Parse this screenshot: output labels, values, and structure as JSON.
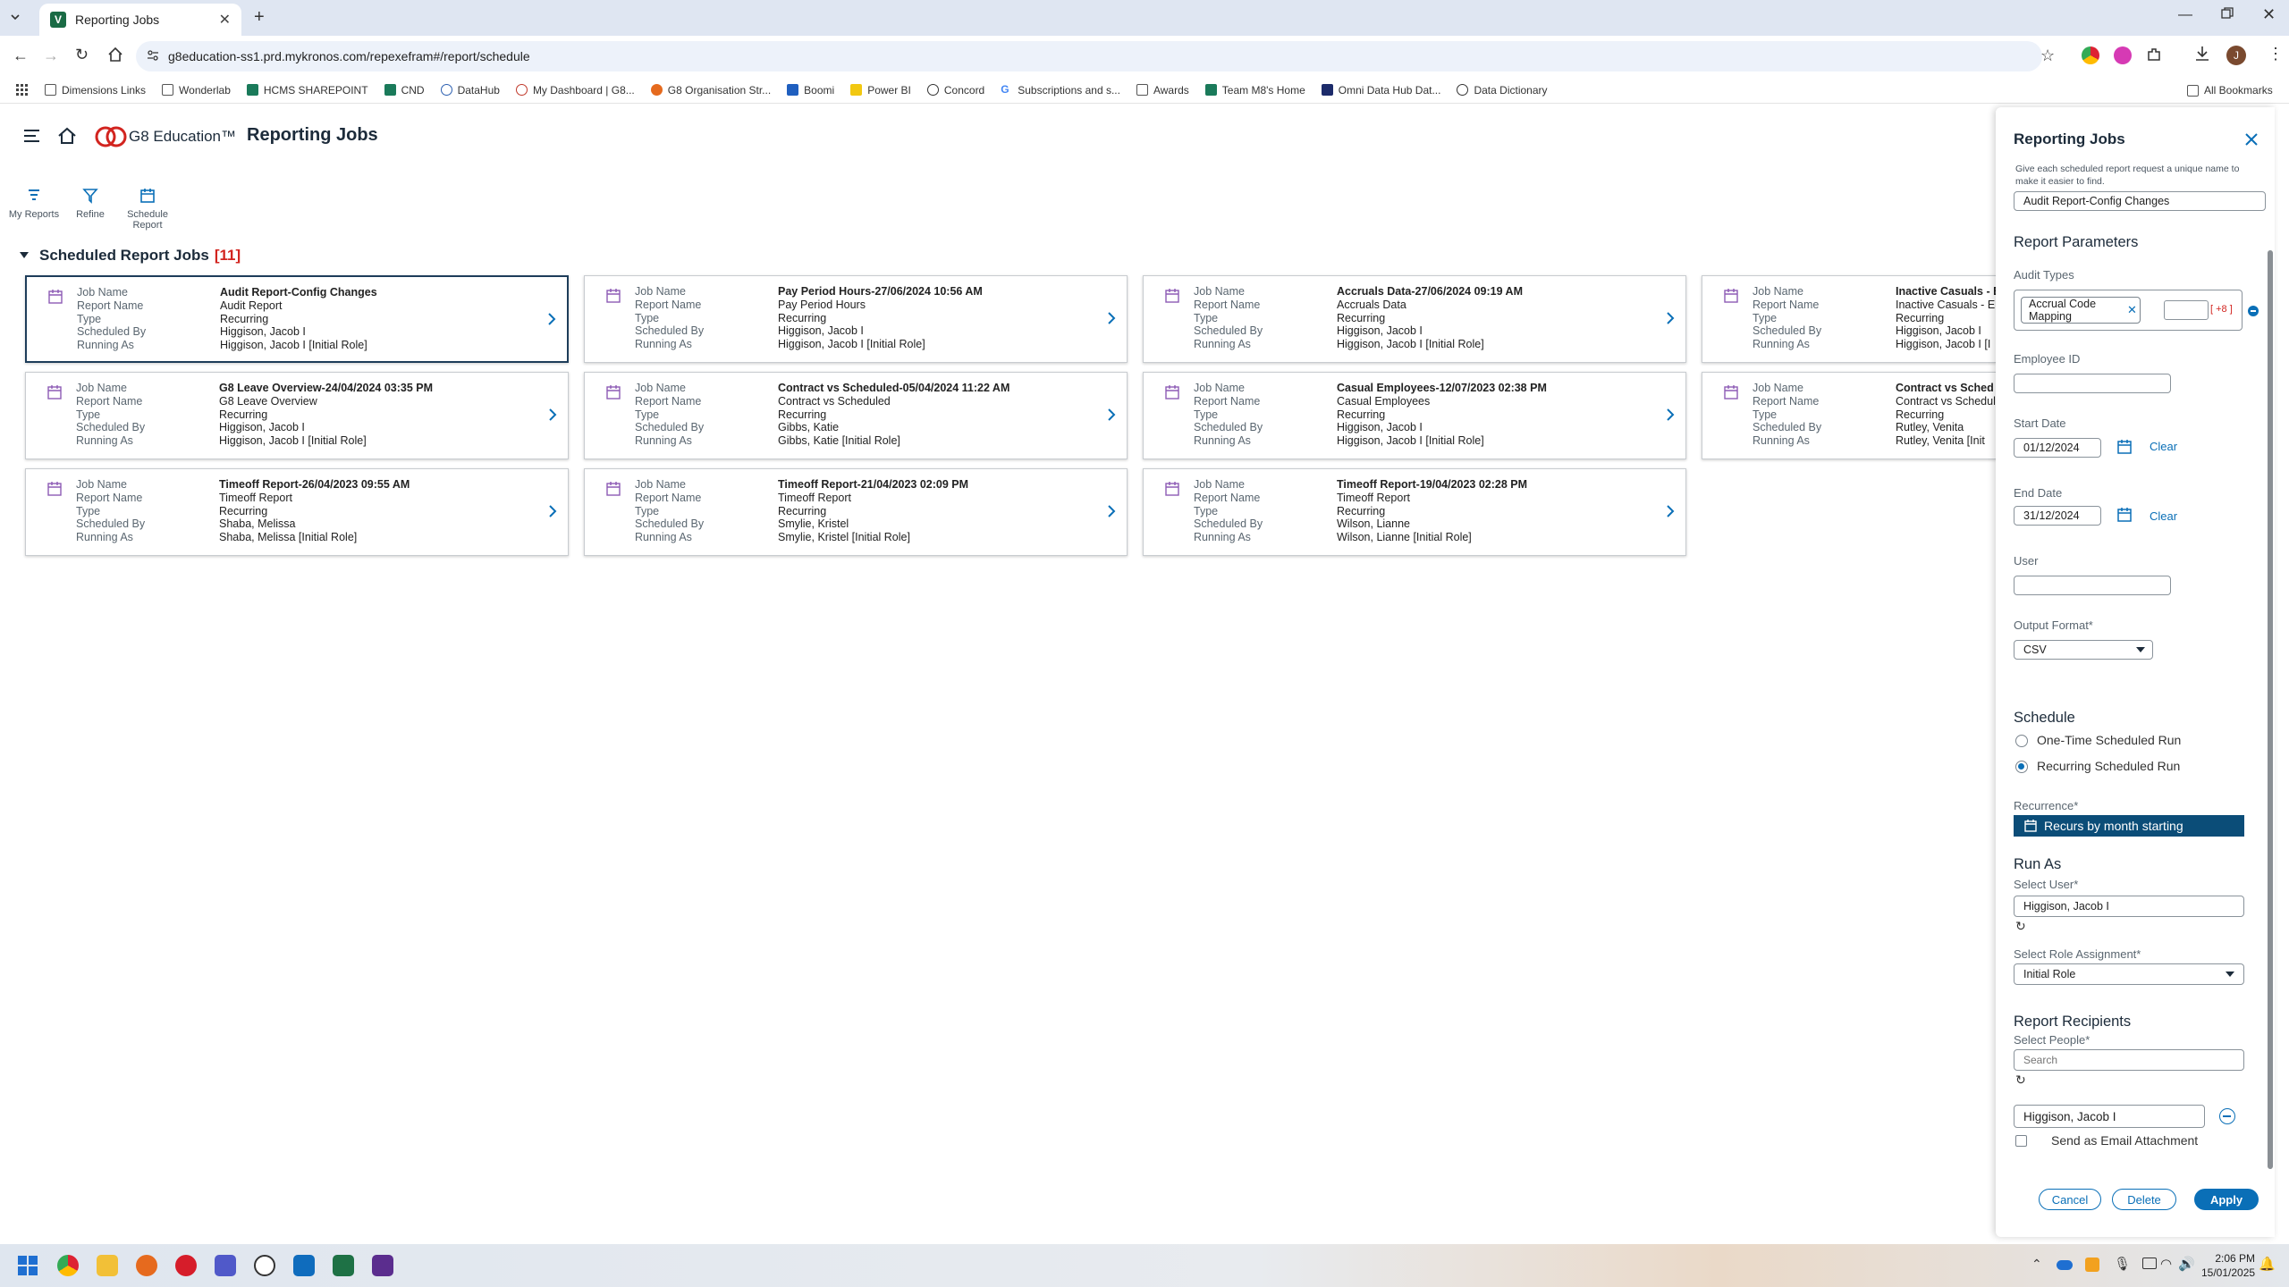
{
  "browser": {
    "tab_title": "Reporting Jobs",
    "url": "g8education-ss1.prd.mykronos.com/repexefram#/report/schedule",
    "all_bookmarks": "All Bookmarks",
    "bookmarks": [
      "Dimensions Links",
      "Wonderlab",
      "HCMS SHAREPOINT",
      "CND",
      "DataHub",
      "My Dashboard | G8...",
      "G8 Organisation Str...",
      "Boomi",
      "Power BI",
      "Concord",
      "Subscriptions and s...",
      "Awards",
      "Team M8's Home",
      "Omni Data Hub Dat...",
      "Data Dictionary"
    ]
  },
  "header": {
    "brand": "G8 Education™",
    "title": "Reporting Jobs"
  },
  "actions": {
    "my_reports": "My Reports",
    "refine": "Refine",
    "schedule_report": "Schedule Report"
  },
  "section": {
    "title": "Scheduled Report Jobs",
    "count": "[11]"
  },
  "card_labels": [
    "Job Name",
    "Report Name",
    "Type",
    "Scheduled By",
    "Running As"
  ],
  "jobs": [
    {
      "job_name": "Audit Report-Config Changes",
      "report_name": "Audit Report",
      "type": "Recurring",
      "scheduled_by": "Higgison, Jacob I",
      "running_as": "Higgison, Jacob I [Initial Role]"
    },
    {
      "job_name": "Pay Period Hours-27/06/2024 10:56 AM",
      "report_name": "Pay Period Hours",
      "type": "Recurring",
      "scheduled_by": "Higgison, Jacob I",
      "running_as": "Higgison, Jacob I [Initial Role]"
    },
    {
      "job_name": "Accruals Data-27/06/2024 09:19 AM",
      "report_name": "Accruals Data",
      "type": "Recurring",
      "scheduled_by": "Higgison, Jacob I",
      "running_as": "Higgison, Jacob I [Initial Role]"
    },
    {
      "job_name": "Inactive Casuals - E",
      "report_name": "Inactive Casuals - El",
      "type": "Recurring",
      "scheduled_by": "Higgison, Jacob I",
      "running_as": "Higgison, Jacob I [I"
    },
    {
      "job_name": "G8 Leave Overview-24/04/2024 03:35 PM",
      "report_name": "G8 Leave Overview",
      "type": "Recurring",
      "scheduled_by": "Higgison, Jacob I",
      "running_as": "Higgison, Jacob I [Initial Role]"
    },
    {
      "job_name": "Contract vs Scheduled-05/04/2024 11:22 AM",
      "report_name": "Contract vs Scheduled",
      "type": "Recurring",
      "scheduled_by": "Gibbs, Katie",
      "running_as": "Gibbs, Katie [Initial Role]"
    },
    {
      "job_name": "Casual Employees-12/07/2023 02:38 PM",
      "report_name": "Casual Employees",
      "type": "Recurring",
      "scheduled_by": "Higgison, Jacob I",
      "running_as": "Higgison, Jacob I [Initial Role]"
    },
    {
      "job_name": "Contract vs Sched",
      "report_name": "Contract vs Schedul",
      "type": "Recurring",
      "scheduled_by": "Rutley, Venita",
      "running_as": "Rutley, Venita [Init"
    },
    {
      "job_name": "Timeoff Report-26/04/2023 09:55 AM",
      "report_name": "Timeoff Report",
      "type": "Recurring",
      "scheduled_by": "Shaba, Melissa",
      "running_as": "Shaba, Melissa [Initial Role]"
    },
    {
      "job_name": "Timeoff Report-21/04/2023 02:09 PM",
      "report_name": "Timeoff Report",
      "type": "Recurring",
      "scheduled_by": "Smylie, Kristel",
      "running_as": "Smylie, Kristel [Initial Role]"
    },
    {
      "job_name": "Timeoff Report-19/04/2023 02:28 PM",
      "report_name": "Timeoff Report",
      "type": "Recurring",
      "scheduled_by": "Wilson, Lianne",
      "running_as": "Wilson, Lianne [Initial Role]"
    }
  ],
  "panel": {
    "title": "Reporting Jobs",
    "help": "Give each scheduled report request a unique name to make it easier to find.",
    "job_name_value": "Audit Report-Config Changes",
    "params_title": "Report Parameters",
    "audit_types_label": "Audit Types",
    "audit_chip": "Accrual Code Mapping",
    "more_count": "[ +8 ]",
    "employee_id_label": "Employee ID",
    "start_date_label": "Start Date",
    "start_date": "01/12/2024",
    "end_date_label": "End Date",
    "end_date": "31/12/2024",
    "clear": "Clear",
    "user_label": "User",
    "output_format_label": "Output Format*",
    "output_format": "CSV",
    "schedule_title": "Schedule",
    "one_time": "One-Time Scheduled Run",
    "recurring": "Recurring Scheduled Run",
    "recurrence_label": "Recurrence*",
    "recurrence_value": "Recurs by month starting",
    "run_as_title": "Run As",
    "select_user_label": "Select User*",
    "select_user": "Higgison, Jacob I",
    "role_label": "Select Role Assignment*",
    "role_value": "Initial Role",
    "recipients_title": "Report Recipients",
    "select_people_label": "Select People*",
    "search_placeholder": "Search",
    "recipient": "Higgison, Jacob I",
    "email_attachment": "Send as Email Attachment",
    "cancel": "Cancel",
    "delete": "Delete",
    "apply": "Apply"
  },
  "taskbar": {
    "time": "2:06 PM",
    "date": "15/01/2025"
  },
  "colors": {
    "accent": "#0a6fb7",
    "navy": "#1c2b3a",
    "count_red": "#d2241f",
    "calendar_purple": "#8d5bb5"
  }
}
